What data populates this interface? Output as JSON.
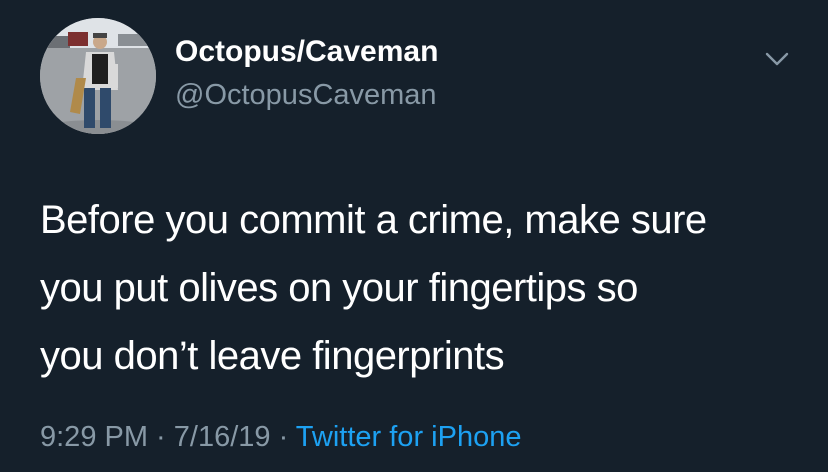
{
  "theme": {
    "background": "#15202b",
    "text_primary": "#ffffff",
    "text_secondary": "#8899a6",
    "link": "#1da1f2"
  },
  "author": {
    "display_name": "Octopus/Caveman",
    "handle": "@OctopusCaveman",
    "avatar_icon": "profile-photo"
  },
  "menu": {
    "icon": "chevron-down-icon"
  },
  "tweet": {
    "lines": [
      "Before you commit a crime, make sure",
      "you put olives on your fingertips so",
      "you don’t leave fingerprints"
    ]
  },
  "meta": {
    "time": "9:29 PM",
    "separator1": " · ",
    "date": "7/16/19",
    "separator2": " · ",
    "source": "Twitter for iPhone"
  }
}
